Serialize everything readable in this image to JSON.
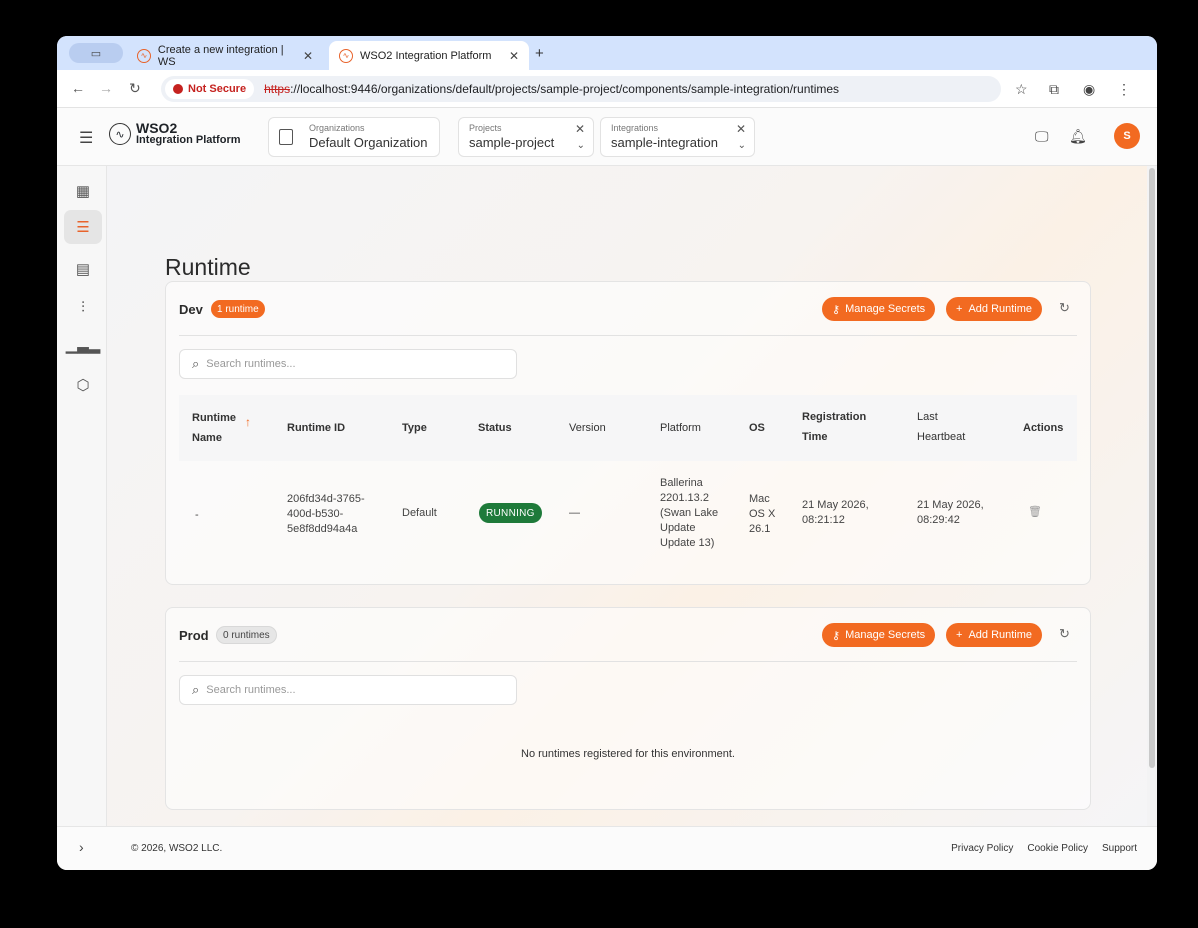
{
  "browser": {
    "tabs": [
      {
        "title": "Create a new integration | WS",
        "active": false
      },
      {
        "title": "WSO2 Integration Platform",
        "active": true
      }
    ],
    "security_label": "Not Secure",
    "url_scheme": "https",
    "url_rest": "://localhost:9446/organizations/default/projects/sample-project/components/sample-integration/runtimes"
  },
  "header": {
    "logo_line1": "WSO2",
    "logo_line2": "Integration Platform",
    "org_caption": "Organizations",
    "org_value": "Default Organization",
    "project_caption": "Projects",
    "project_value": "sample-project",
    "integration_caption": "Integrations",
    "integration_value": "sample-integration",
    "avatar_initial": "S"
  },
  "page": {
    "title": "Runtime"
  },
  "dev": {
    "name": "Dev",
    "badge": "1 runtime",
    "manage_secrets": "Manage Secrets",
    "add_runtime": "Add Runtime",
    "search_placeholder": "Search runtimes...",
    "columns": [
      "Runtime Name",
      "Runtime ID",
      "Type",
      "Status",
      "Version",
      "Platform",
      "OS",
      "Registration Time",
      "Last Heartbeat",
      "Actions"
    ],
    "row": {
      "name": "-",
      "id": "206fd34d-3765-400d-b530-5e8f8dd94a4a",
      "type": "Default",
      "status": "RUNNING",
      "version": "—",
      "platform": "Ballerina 2201.13.2 (Swan Lake Update Update 13)",
      "os": "Mac OS X 26.1",
      "registration": "21 May 2026, 08:21:12",
      "heartbeat": "21 May 2026, 08:29:42"
    }
  },
  "prod": {
    "name": "Prod",
    "badge": "0 runtimes",
    "manage_secrets": "Manage Secrets",
    "add_runtime": "Add Runtime",
    "search_placeholder": "Search runtimes...",
    "empty_text": "No runtimes registered for this environment."
  },
  "footer": {
    "copyright": "© 2026, WSO2 LLC.",
    "privacy": "Privacy Policy",
    "cookie": "Cookie Policy",
    "support": "Support"
  },
  "colors": {
    "accent": "#f26a21",
    "running": "#1e7a3a"
  }
}
